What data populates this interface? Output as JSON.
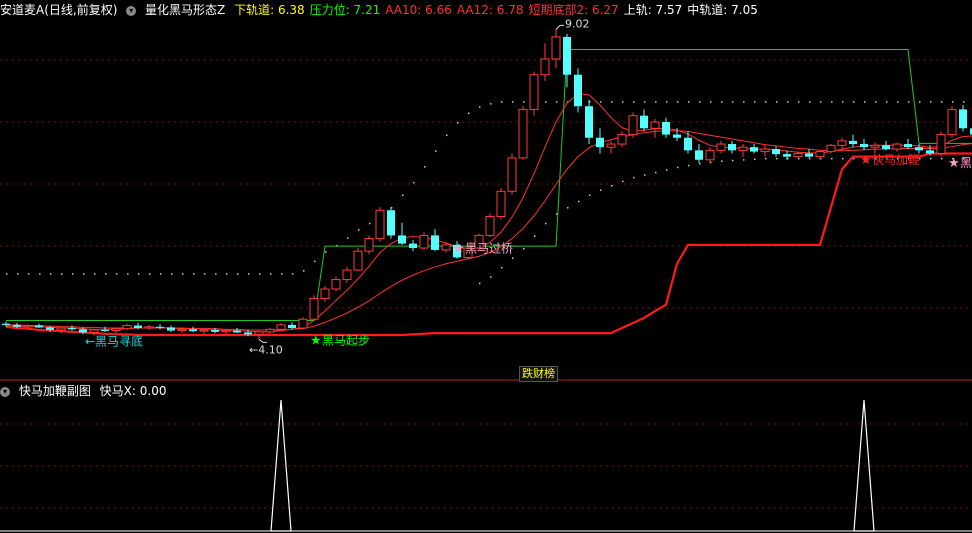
{
  "main_header": {
    "stock": "安道麦A(日线,前复权)",
    "indicator": "量化黑马形态Z",
    "items": [
      {
        "label": "下轨道:",
        "value": "6.38",
        "color": "#ffff00"
      },
      {
        "label": "压力位:",
        "value": "7.21",
        "color": "#00ff00"
      },
      {
        "label": "AA10:",
        "value": "6.66",
        "color": "#ff3030"
      },
      {
        "label": "AA12:",
        "value": "6.78",
        "color": "#ff3030"
      },
      {
        "label": "短期底部2:",
        "value": "6.27",
        "color": "#ff3030"
      },
      {
        "label": "上轨:",
        "value": "7.57",
        "color": "#ffffff"
      },
      {
        "label": "中轨道:",
        "value": "7.05",
        "color": "#ffffff"
      }
    ]
  },
  "sub_header": {
    "indicator": "快马加鞭副图",
    "items": [
      {
        "label": "快马X:",
        "value": "0.00",
        "color": "#ffffff"
      }
    ]
  },
  "divider_tag": "跌财榜",
  "chart_data": {
    "type": "candlestick",
    "price_range": [
      3.9,
      9.2
    ],
    "grid": true,
    "candles": [
      [
        4.35,
        4.38,
        4.3,
        4.33
      ],
      [
        4.33,
        4.36,
        4.28,
        4.3
      ],
      [
        4.3,
        4.34,
        4.26,
        4.32
      ],
      [
        4.32,
        4.35,
        4.28,
        4.29
      ],
      [
        4.29,
        4.31,
        4.22,
        4.25
      ],
      [
        4.25,
        4.3,
        4.2,
        4.28
      ],
      [
        4.28,
        4.32,
        4.24,
        4.26
      ],
      [
        4.26,
        4.29,
        4.18,
        4.21
      ],
      [
        4.21,
        4.27,
        4.17,
        4.25
      ],
      [
        4.25,
        4.3,
        4.22,
        4.24
      ],
      [
        4.24,
        4.28,
        4.2,
        4.27
      ],
      [
        4.27,
        4.35,
        4.25,
        4.32
      ],
      [
        4.32,
        4.36,
        4.26,
        4.28
      ],
      [
        4.28,
        4.33,
        4.25,
        4.3
      ],
      [
        4.3,
        4.34,
        4.26,
        4.29
      ],
      [
        4.29,
        4.32,
        4.22,
        4.24
      ],
      [
        4.24,
        4.28,
        4.2,
        4.26
      ],
      [
        4.26,
        4.3,
        4.22,
        4.23
      ],
      [
        4.23,
        4.27,
        4.19,
        4.25
      ],
      [
        4.25,
        4.28,
        4.2,
        4.22
      ],
      [
        4.22,
        4.26,
        4.18,
        4.24
      ],
      [
        4.24,
        4.28,
        4.2,
        4.21
      ],
      [
        4.21,
        4.25,
        4.15,
        4.18
      ],
      [
        4.18,
        4.24,
        4.1,
        4.22
      ],
      [
        4.22,
        4.28,
        4.19,
        4.26
      ],
      [
        4.26,
        4.36,
        4.24,
        4.33
      ],
      [
        4.33,
        4.37,
        4.26,
        4.28
      ],
      [
        4.28,
        4.45,
        4.27,
        4.42
      ],
      [
        4.42,
        4.8,
        4.4,
        4.75
      ],
      [
        4.75,
        4.95,
        4.7,
        4.9
      ],
      [
        4.9,
        5.1,
        4.86,
        5.05
      ],
      [
        5.05,
        5.25,
        5.0,
        5.2
      ],
      [
        5.2,
        5.55,
        5.18,
        5.5
      ],
      [
        5.5,
        5.75,
        5.45,
        5.7
      ],
      [
        5.7,
        6.2,
        5.65,
        6.15
      ],
      [
        6.15,
        6.2,
        5.7,
        5.75
      ],
      [
        5.75,
        5.95,
        5.6,
        5.62
      ],
      [
        5.62,
        5.68,
        5.5,
        5.55
      ],
      [
        5.55,
        5.8,
        5.52,
        5.75
      ],
      [
        5.75,
        5.85,
        5.5,
        5.52
      ],
      [
        5.52,
        5.65,
        5.48,
        5.6
      ],
      [
        5.6,
        5.66,
        5.38,
        5.4
      ],
      [
        5.4,
        5.58,
        5.38,
        5.55
      ],
      [
        5.55,
        5.78,
        5.52,
        5.75
      ],
      [
        5.75,
        6.1,
        5.72,
        6.05
      ],
      [
        6.05,
        6.5,
        6.0,
        6.45
      ],
      [
        6.45,
        7.05,
        6.4,
        6.98
      ],
      [
        6.98,
        7.8,
        6.95,
        7.75
      ],
      [
        7.75,
        8.35,
        7.65,
        8.3
      ],
      [
        8.3,
        8.8,
        8.2,
        8.55
      ],
      [
        8.55,
        9.02,
        8.4,
        8.9
      ],
      [
        8.9,
        8.95,
        8.1,
        8.3
      ],
      [
        8.3,
        8.4,
        7.7,
        7.8
      ],
      [
        7.8,
        7.9,
        7.2,
        7.3
      ],
      [
        7.3,
        7.45,
        7.05,
        7.15
      ],
      [
        7.15,
        7.25,
        7.05,
        7.2
      ],
      [
        7.2,
        7.4,
        7.15,
        7.35
      ],
      [
        7.35,
        7.7,
        7.3,
        7.65
      ],
      [
        7.65,
        7.75,
        7.4,
        7.45
      ],
      [
        7.45,
        7.6,
        7.3,
        7.55
      ],
      [
        7.55,
        7.62,
        7.3,
        7.35
      ],
      [
        7.35,
        7.45,
        7.25,
        7.3
      ],
      [
        7.3,
        7.4,
        7.05,
        7.1
      ],
      [
        7.1,
        7.2,
        6.9,
        6.95
      ],
      [
        6.95,
        7.15,
        6.9,
        7.1
      ],
      [
        7.1,
        7.25,
        7.05,
        7.2
      ],
      [
        7.2,
        7.25,
        7.05,
        7.1
      ],
      [
        7.1,
        7.2,
        7.0,
        7.15
      ],
      [
        7.15,
        7.2,
        7.05,
        7.08
      ],
      [
        7.08,
        7.18,
        7.0,
        7.12
      ],
      [
        7.12,
        7.16,
        7.0,
        7.04
      ],
      [
        7.04,
        7.1,
        6.95,
        7.0
      ],
      [
        7.0,
        7.08,
        6.98,
        7.05
      ],
      [
        7.05,
        7.12,
        6.98,
        7.0
      ],
      [
        7.0,
        7.1,
        6.95,
        7.08
      ],
      [
        7.08,
        7.2,
        7.05,
        7.18
      ],
      [
        7.18,
        7.3,
        7.1,
        7.25
      ],
      [
        7.25,
        7.35,
        7.15,
        7.2
      ],
      [
        7.2,
        7.28,
        7.1,
        7.15
      ],
      [
        7.15,
        7.22,
        7.05,
        7.18
      ],
      [
        7.18,
        7.25,
        7.1,
        7.12
      ],
      [
        7.12,
        7.22,
        7.08,
        7.2
      ],
      [
        7.2,
        7.28,
        7.12,
        7.15
      ],
      [
        7.15,
        7.2,
        7.05,
        7.1
      ],
      [
        7.1,
        7.18,
        7.02,
        7.05
      ],
      [
        7.05,
        7.4,
        7.0,
        7.35
      ],
      [
        7.35,
        7.8,
        7.3,
        7.75
      ],
      [
        7.75,
        7.82,
        7.4,
        7.45
      ],
      [
        7.45,
        7.55,
        7.3,
        7.35
      ]
    ],
    "ma_fast": [
      4.32,
      4.31,
      4.3,
      4.3,
      4.29,
      4.28,
      4.28,
      4.27,
      4.26,
      4.26,
      4.26,
      4.27,
      4.28,
      4.28,
      4.29,
      4.28,
      4.27,
      4.27,
      4.26,
      4.25,
      4.24,
      4.24,
      4.23,
      4.22,
      4.22,
      4.24,
      4.26,
      4.29,
      4.4,
      4.55,
      4.72,
      4.88,
      5.06,
      5.26,
      5.48,
      5.62,
      5.71,
      5.73,
      5.72,
      5.68,
      5.63,
      5.57,
      5.53,
      5.56,
      5.64,
      5.8,
      6.04,
      6.35,
      6.73,
      7.15,
      7.55,
      7.85,
      8.0,
      7.98,
      7.82,
      7.62,
      7.46,
      7.4,
      7.42,
      7.44,
      7.45,
      7.42,
      7.36,
      7.26,
      7.18,
      7.15,
      7.14,
      7.13,
      7.12,
      7.12,
      7.11,
      7.09,
      7.07,
      7.06,
      7.06,
      7.08,
      7.12,
      7.15,
      7.17,
      7.18,
      7.18,
      7.18,
      7.18,
      7.17,
      7.15,
      7.16,
      7.26,
      7.32,
      7.33
    ],
    "ma_slow": [
      4.33,
      4.33,
      4.32,
      4.32,
      4.31,
      4.3,
      4.3,
      4.29,
      4.29,
      4.28,
      4.28,
      4.28,
      4.28,
      4.28,
      4.28,
      4.28,
      4.28,
      4.27,
      4.27,
      4.27,
      4.26,
      4.26,
      4.25,
      4.25,
      4.25,
      4.25,
      4.26,
      4.27,
      4.31,
      4.37,
      4.44,
      4.52,
      4.61,
      4.71,
      4.83,
      4.94,
      5.04,
      5.12,
      5.19,
      5.25,
      5.3,
      5.34,
      5.38,
      5.42,
      5.48,
      5.57,
      5.7,
      5.86,
      6.06,
      6.3,
      6.56,
      6.8,
      7.0,
      7.14,
      7.22,
      7.27,
      7.31,
      7.35,
      7.38,
      7.4,
      7.41,
      7.41,
      7.4,
      7.37,
      7.34,
      7.31,
      7.28,
      7.25,
      7.22,
      7.19,
      7.17,
      7.15,
      7.13,
      7.12,
      7.1,
      7.1,
      7.1,
      7.1,
      7.11,
      7.12,
      7.12,
      7.13,
      7.13,
      7.13,
      7.13,
      7.13,
      7.16,
      7.19,
      7.21
    ],
    "stair_line": [
      4.4,
      4.4,
      4.4,
      4.4,
      4.4,
      4.4,
      4.4,
      4.4,
      4.4,
      4.4,
      4.4,
      4.4,
      4.4,
      4.4,
      4.4,
      4.4,
      4.4,
      4.4,
      4.4,
      4.4,
      4.4,
      4.4,
      4.4,
      4.4,
      4.4,
      4.4,
      4.4,
      4.4,
      4.4,
      5.58,
      5.58,
      5.58,
      5.58,
      5.58,
      5.58,
      5.58,
      5.58,
      5.58,
      5.58,
      5.58,
      5.58,
      5.58,
      5.58,
      5.58,
      5.58,
      5.58,
      5.58,
      5.58,
      5.58,
      5.58,
      5.58,
      8.7,
      8.7,
      8.7,
      8.7,
      8.7,
      8.7,
      8.7,
      8.7,
      8.7,
      8.7,
      8.7,
      8.7,
      8.7,
      8.7,
      8.7,
      8.7,
      8.7,
      8.7,
      8.7,
      8.7,
      8.7,
      8.7,
      8.7,
      8.7,
      8.7,
      8.7,
      8.7,
      8.7,
      8.7,
      8.7,
      8.7,
      8.7,
      7.21,
      7.21,
      7.21,
      7.21,
      7.21,
      7.21
    ],
    "support_line": [
      4.3,
      4.28,
      4.27,
      4.25,
      4.24,
      4.23,
      4.22,
      4.21,
      4.2,
      4.19,
      4.18,
      4.18,
      4.17,
      4.17,
      4.17,
      4.17,
      4.17,
      4.17,
      4.17,
      4.17,
      4.17,
      4.17,
      4.17,
      4.17,
      4.17,
      4.17,
      4.17,
      4.17,
      4.17,
      4.17,
      4.17,
      4.17,
      4.17,
      4.17,
      4.17,
      4.17,
      4.17,
      4.18,
      4.19,
      4.2,
      4.2,
      4.2,
      4.2,
      4.2,
      4.2,
      4.2,
      4.2,
      4.2,
      4.2,
      4.2,
      4.2,
      4.2,
      4.2,
      4.2,
      4.2,
      4.2,
      4.28,
      4.36,
      4.44,
      4.55,
      4.65,
      5.3,
      5.6,
      5.6,
      5.6,
      5.6,
      5.6,
      5.6,
      5.6,
      5.6,
      5.6,
      5.6,
      5.6,
      5.6,
      5.6,
      6.2,
      6.8,
      7.0,
      7.0,
      7.0,
      7.0,
      7.0,
      7.0,
      7.0,
      7.05,
      7.05,
      7.05,
      7.05,
      7.05
    ],
    "upper_dots": [
      5.15,
      5.15,
      5.15,
      5.15,
      5.15,
      5.15,
      5.15,
      5.15,
      5.15,
      5.15,
      5.15,
      5.15,
      5.15,
      5.15,
      5.15,
      5.15,
      5.15,
      5.15,
      5.15,
      5.15,
      5.15,
      5.15,
      5.15,
      5.15,
      5.15,
      5.15,
      5.15,
      5.2,
      5.35,
      5.5,
      5.6,
      5.72,
      5.85,
      5.95,
      6.05,
      6.2,
      6.4,
      6.6,
      6.85,
      7.1,
      7.35,
      7.55,
      7.7,
      7.8,
      7.85,
      7.88,
      7.88,
      7.88,
      7.88,
      7.88,
      7.88,
      7.88,
      7.88,
      7.88,
      7.88,
      7.88,
      7.88,
      7.88,
      7.88,
      7.88,
      7.88,
      7.88,
      7.88,
      7.88,
      7.88,
      7.88,
      7.88,
      7.88,
      7.88,
      7.88,
      7.88,
      7.88,
      7.88,
      7.88,
      7.88,
      7.88,
      7.88,
      7.88,
      7.88,
      7.88,
      7.88,
      7.88,
      7.88,
      7.88,
      7.88,
      7.88,
      7.88,
      7.88,
      7.88
    ],
    "lower_dots": [
      null,
      null,
      null,
      null,
      null,
      null,
      null,
      null,
      null,
      null,
      null,
      null,
      null,
      null,
      null,
      null,
      null,
      null,
      null,
      null,
      null,
      null,
      null,
      null,
      null,
      null,
      null,
      null,
      null,
      null,
      null,
      null,
      null,
      null,
      null,
      null,
      null,
      null,
      null,
      null,
      null,
      null,
      null,
      5.0,
      5.1,
      5.25,
      5.4,
      5.55,
      5.75,
      5.95,
      6.1,
      6.2,
      6.3,
      6.4,
      6.48,
      6.55,
      6.62,
      6.68,
      6.72,
      6.76,
      6.8,
      6.84,
      6.87,
      6.9,
      6.92,
      6.94,
      6.95,
      6.96,
      6.97,
      6.98,
      6.98,
      6.98,
      6.98,
      6.98,
      6.98,
      6.98,
      6.98,
      6.98,
      6.98,
      6.98,
      6.98,
      6.98,
      6.98,
      6.98,
      6.98,
      6.98,
      6.98,
      6.98,
      6.98
    ],
    "annotations": [
      {
        "index": 50,
        "price": 9.02,
        "text": "9.02",
        "kind": "high",
        "color": "#dddddd"
      },
      {
        "index": 23,
        "price": 4.1,
        "text": "4.10",
        "kind": "low",
        "color": "#dddddd"
      },
      {
        "index": 3,
        "price": 4.07,
        "text": "黑马寻底",
        "kind": "label",
        "color": "#00e0e0"
      },
      {
        "index": 28,
        "price": 4.08,
        "text": "黑马起步",
        "kind": "star",
        "color": "#00ff00"
      },
      {
        "index": 41,
        "price": 5.54,
        "text": "黑马过桥",
        "kind": "star",
        "color": "#ff9ec8"
      },
      {
        "index": 78,
        "price": 6.95,
        "text": "快马加鞭",
        "kind": "star",
        "color": "#ff2020"
      },
      {
        "index": 86,
        "price": 6.9,
        "text": "黑马",
        "kind": "star",
        "color": "#ff9ec8"
      }
    ],
    "sub_chart": {
      "type": "area",
      "name": "快马X",
      "y_range": [
        0,
        1
      ],
      "spikes": [
        25,
        78
      ]
    }
  }
}
